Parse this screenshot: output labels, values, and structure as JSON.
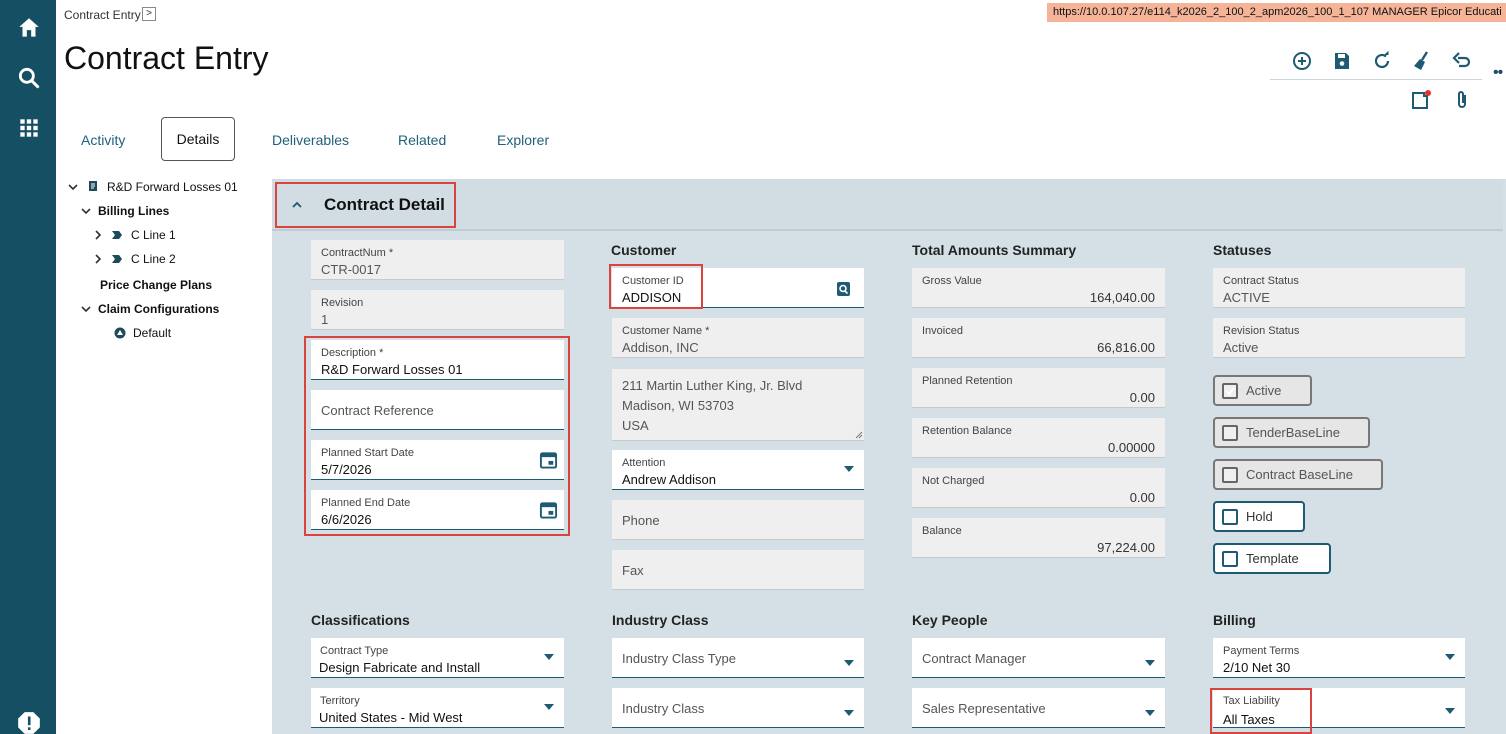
{
  "header": {
    "breadcrumb": "Contract Entry",
    "breadcrumb_chevron": ">",
    "url_bar": "https://10.0.107.27/e114_k2026_2_100_2_apm2026_100_1_107   MANAGER   Epicor Educati",
    "title": "Contract Entry",
    "more_dots": "••"
  },
  "icons": {
    "rail": [
      "home-icon",
      "search-icon",
      "apps-grid-icon",
      "alert-icon"
    ],
    "toolbar": [
      "add-new-icon",
      "save-icon",
      "refresh-icon",
      "clear-icon",
      "undo-icon",
      "notes-icon",
      "attachment-icon"
    ]
  },
  "colors": {
    "rail": "#154f63",
    "accent": "#1e5a71",
    "highlight": "#d9443f",
    "url_bar": "#f5b398"
  },
  "tabs": [
    {
      "label": "Activity"
    },
    {
      "label": "Details",
      "active": true
    },
    {
      "label": "Deliverables"
    },
    {
      "label": "Related"
    },
    {
      "label": "Explorer"
    }
  ],
  "tree": {
    "root": "R&D Forward Losses 01",
    "billing_lines": "Billing Lines",
    "line1": "C Line 1",
    "line2": "C Line 2",
    "price_change_plans": "Price Change Plans",
    "claim_configurations": "Claim Configurations",
    "default": "Default"
  },
  "panel": {
    "title": "Contract Detail"
  },
  "contract": {
    "contract_num_label": "ContractNum *",
    "contract_num": "CTR-0017",
    "revision_label": "Revision",
    "revision": "1",
    "description_label": "Description *",
    "description": "R&D Forward Losses 01",
    "contract_reference_placeholder": "Contract Reference",
    "planned_start_label": "Planned Start Date",
    "planned_start": "5/7/2026",
    "planned_end_label": "Planned End Date",
    "planned_end": "6/6/2026"
  },
  "customer": {
    "section": "Customer",
    "id_label": "Customer ID",
    "id": "ADDISON",
    "name_label": "Customer Name *",
    "name": "Addison, INC",
    "address_line1": "211 Martin Luther King, Jr. Blvd",
    "address_line2": "Madison, WI  53703",
    "address_line3": "USA",
    "attention_label": "Attention",
    "attention": "Andrew Addison",
    "phone_placeholder": "Phone",
    "fax_placeholder": "Fax"
  },
  "totals": {
    "section": "Total Amounts Summary",
    "gross_label": "Gross Value",
    "gross": "164,040.00",
    "invoiced_label": "Invoiced",
    "invoiced": "66,816.00",
    "planned_retention_label": "Planned Retention",
    "planned_retention": "0.00",
    "retention_balance_label": "Retention Balance",
    "retention_balance": "0.00000",
    "not_charged_label": "Not Charged",
    "not_charged": "0.00",
    "balance_label": "Balance",
    "balance": "97,224.00"
  },
  "statuses": {
    "section": "Statuses",
    "contract_status_label": "Contract Status",
    "contract_status": "ACTIVE",
    "revision_status_label": "Revision Status",
    "revision_status": "Active",
    "active_label": "Active",
    "active_checked": true,
    "tender_label": "TenderBaseLine",
    "tender_checked": false,
    "contract_baseline_label": "Contract BaseLine",
    "contract_baseline_checked": false,
    "hold_label": "Hold",
    "hold_checked": false,
    "template_label": "Template",
    "template_checked": false
  },
  "classifications": {
    "section": "Classifications",
    "type_label": "Contract Type",
    "type": "Design Fabricate and Install",
    "territory_label": "Territory",
    "territory": "United States - Mid West"
  },
  "industry": {
    "section": "Industry Class",
    "type_placeholder": "Industry Class Type",
    "class_placeholder": "Industry Class"
  },
  "key_people": {
    "section": "Key People",
    "manager_placeholder": "Contract Manager",
    "sales_placeholder": "Sales Representative"
  },
  "billing": {
    "section": "Billing",
    "payment_terms_label": "Payment Terms",
    "payment_terms": "2/10 Net 30",
    "tax_label": "Tax Liability",
    "tax": "All Taxes"
  }
}
